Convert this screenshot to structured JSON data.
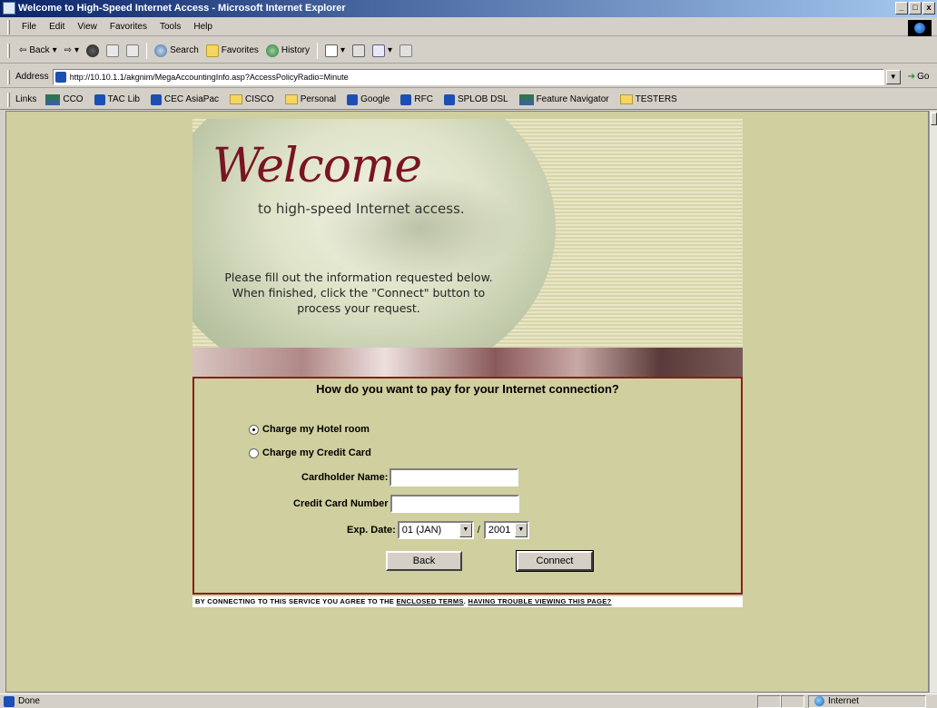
{
  "window": {
    "title": "Welcome to High-Speed Internet Access - Microsoft Internet Explorer",
    "min_glyph": "_",
    "max_glyph": "□",
    "close_glyph": "x"
  },
  "menu": [
    "File",
    "Edit",
    "View",
    "Favorites",
    "Tools",
    "Help"
  ],
  "toolbar": {
    "back": "Back",
    "search": "Search",
    "favorites": "Favorites",
    "history": "History"
  },
  "address": {
    "label": "Address",
    "url": "http://10.10.1.1/akgnim/MegaAccountingInfo.asp?AccessPolicyRadio=Minute",
    "go": "Go"
  },
  "links": {
    "label": "Links",
    "items": [
      {
        "label": "CCO",
        "icon": "cisco-icon"
      },
      {
        "label": "TAC Lib",
        "icon": "page-icon"
      },
      {
        "label": "CEC AsiaPac",
        "icon": "page-icon"
      },
      {
        "label": "CISCO",
        "icon": "folder-icon"
      },
      {
        "label": "Personal",
        "icon": "folder-icon"
      },
      {
        "label": "Google",
        "icon": "page-icon"
      },
      {
        "label": "RFC",
        "icon": "page-icon"
      },
      {
        "label": "SPLOB DSL",
        "icon": "page-icon"
      },
      {
        "label": "Feature Navigator",
        "icon": "cisco-icon"
      },
      {
        "label": "TESTERS",
        "icon": "folder-icon"
      }
    ]
  },
  "hero": {
    "welcome": "Welcome",
    "subtitle": "to high-speed Internet access.",
    "instructions": "Please fill out the information requested below. When finished, click the \"Connect\" button to process your request."
  },
  "form": {
    "question": "How do you want to pay for your Internet connection?",
    "option_room": "Charge my Hotel room",
    "option_card": "Charge my Credit Card",
    "selected": "room",
    "cardholder_label": "Cardholder Name:",
    "cardnumber_label": "Credit Card Number",
    "exp_label": "Exp. Date:",
    "exp_month": "01 (JAN)",
    "exp_separator": "/",
    "exp_year": "2001",
    "back_button": "Back",
    "connect_button": "Connect"
  },
  "footer": {
    "prefix": "BY CONNECTING TO THIS SERVICE YOU AGREE TO THE ",
    "terms_link": "ENCLOSED TERMS",
    "separator": ". ",
    "trouble_link": "HAVING TROUBLE VIEWING THIS PAGE?"
  },
  "status": {
    "left": "Done",
    "zone": "Internet"
  },
  "colors": {
    "page_background": "#cfcf9f",
    "form_border": "#8a1e1e",
    "welcome_text": "#7a1422"
  }
}
